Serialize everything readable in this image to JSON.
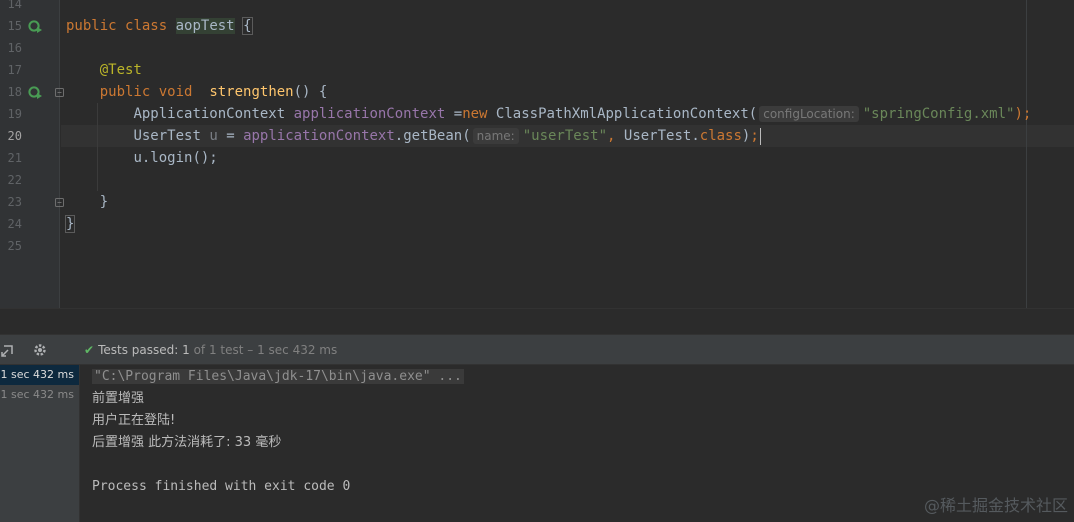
{
  "editor": {
    "line_numbers": [
      "14",
      "15",
      "16",
      "17",
      "18",
      "19",
      "20",
      "21",
      "22",
      "23",
      "24",
      "25"
    ],
    "current_line": "20",
    "code": {
      "l15_kw1": "public",
      "l15_kw2": "class",
      "l15_class": "aopTest",
      "l15_brace": "{",
      "l17_annotation": "@Test",
      "l18_kw1": "public",
      "l18_kw2": "void",
      "l18_method": "strengthen",
      "l18_tail": "() {",
      "l19_type": "ApplicationContext",
      "l19_var": "applicationContext",
      "l19_eq": "=",
      "l19_new": "new",
      "l19_ctor": "ClassPathXmlApplicationContext(",
      "l19_hint": "configLocation:",
      "l19_str": "\"springConfig.xml\"",
      "l19_end": ");",
      "l20_type": "UserTest",
      "l20_var": "u",
      "l20_eq": "=",
      "l20_ref": "applicationContext",
      "l20_call": ".getBean(",
      "l20_hint": "name:",
      "l20_str": "\"userTest\"",
      "l20_comma": ",",
      "l20_cls": "UserTest",
      "l20_dot": ".",
      "l20_classkw": "class",
      "l20_close": ")",
      "l20_semi": ";",
      "l21_text": "u.login();",
      "l23_brace": "}",
      "l24_brace": "}"
    }
  },
  "run": {
    "status_prefix": "Tests passed:",
    "status_count": "1",
    "status_suffix": "of 1 test – 1 sec 432 ms",
    "tree_rows": [
      "1 sec 432 ms",
      "1 sec 432 ms"
    ],
    "console": {
      "cmd": "\"C:\\Program Files\\Java\\jdk-17\\bin\\java.exe\" ...",
      "out1": "前置增强",
      "out2": "用户正在登陆!",
      "out3": "后置增强 此方法消耗了: 33 毫秒",
      "exit": "Process finished with exit code 0"
    }
  },
  "watermark": "@稀土掘金技术社区",
  "icons": {
    "run_gutter": "run-test-icon",
    "fold": "fold-icon",
    "pin": "pin-tab-icon",
    "settings": "gear-icon",
    "check": "check-icon"
  },
  "colors": {
    "keyword": "#cc7832",
    "annotation": "#bbb529",
    "method": "#ffc66d",
    "field": "#9876aa",
    "string": "#6a8759",
    "pass": "#5fb865"
  }
}
